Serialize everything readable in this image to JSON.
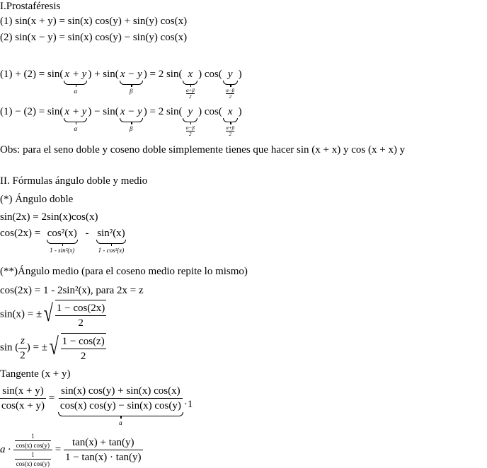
{
  "section1": {
    "title": "I.Prostaféresis",
    "eq1": "(1) sin(x + y) = sin(x) cos(y) + sin(y) cos(x)",
    "eq2": "(2) sin(x − y) = sin(x) cos(y) − sin(y) cos(x)",
    "sum": {
      "p1": "(1) + (2) = sin(",
      "b1": "x + y",
      "l1": "α",
      "p2": ") + sin(",
      "b2": "x − y",
      "l2": "β",
      "p3": ") = 2 sin(",
      "b3": "x",
      "l3": [
        "α+β",
        "2"
      ],
      "p4": ") cos(",
      "b4": "y",
      "l4": [
        "α−β",
        "2"
      ],
      "p5": ")"
    },
    "diff": {
      "p1": "(1) − (2) = sin(",
      "b1": "x + y",
      "l1": "α",
      "p2": ") − sin(",
      "b2": "x − y",
      "l2": "β",
      "p3": ") = 2 sin(",
      "b3": "y",
      "l3": [
        "α−β",
        "2"
      ],
      "p4": ") cos(",
      "b4": "x",
      "l4": [
        "α+β",
        "2"
      ],
      "p5": ")"
    },
    "obs": "Obs: para el seno doble y coseno doble simplemente tienes que hacer sin (x + x) y cos (x + x) y"
  },
  "section2": {
    "title": "II. Fórmulas ángulo doble y medio",
    "double_title": "(*) Ángulo doble",
    "sin2x": "sin(2x) = 2sin(x)cos(x)",
    "cos2x": {
      "p1": "cos(2x) = ",
      "b1": "cos²(x)",
      "l1": "1 - sin²(x)",
      "p2": " - ",
      "b2": "sin²(x)",
      "l2": "1 - cos²(x)"
    },
    "half_title": "(**)Ángulo medio (para el coseno medio repite lo mismo)",
    "cos2x_alt": "cos(2x) = 1 - 2sin²(x),  para 2x = z",
    "sinx": {
      "lhs": "sin(x) = ±",
      "num": "1 − cos(2x)",
      "den": "2"
    },
    "sinz2": {
      "lhs1": "sin (",
      "num": "z",
      "den": "2",
      "lhs2": ") = ±",
      "rnum": "1 − cos(z)",
      "rden": "2"
    },
    "tan_title": "Tangente (x + y)",
    "tan1": {
      "lnum": "sin(x + y)",
      "lden": "cos(x + y)",
      "eq": " = ",
      "rnum": "sin(x) cos(y) + sin(x) cos(x)",
      "rden": "cos(x) cos(y) − sin(x) cos(y)",
      "brace": "a",
      "tail": "·1"
    },
    "tan2": {
      "a": "a · ",
      "one": "1",
      "cc": "cos(x) cos(y)",
      "eq": " = ",
      "rnum": "tan(x) + tan(y)",
      "rden": "1 − tan(x) · tan(y)"
    }
  }
}
